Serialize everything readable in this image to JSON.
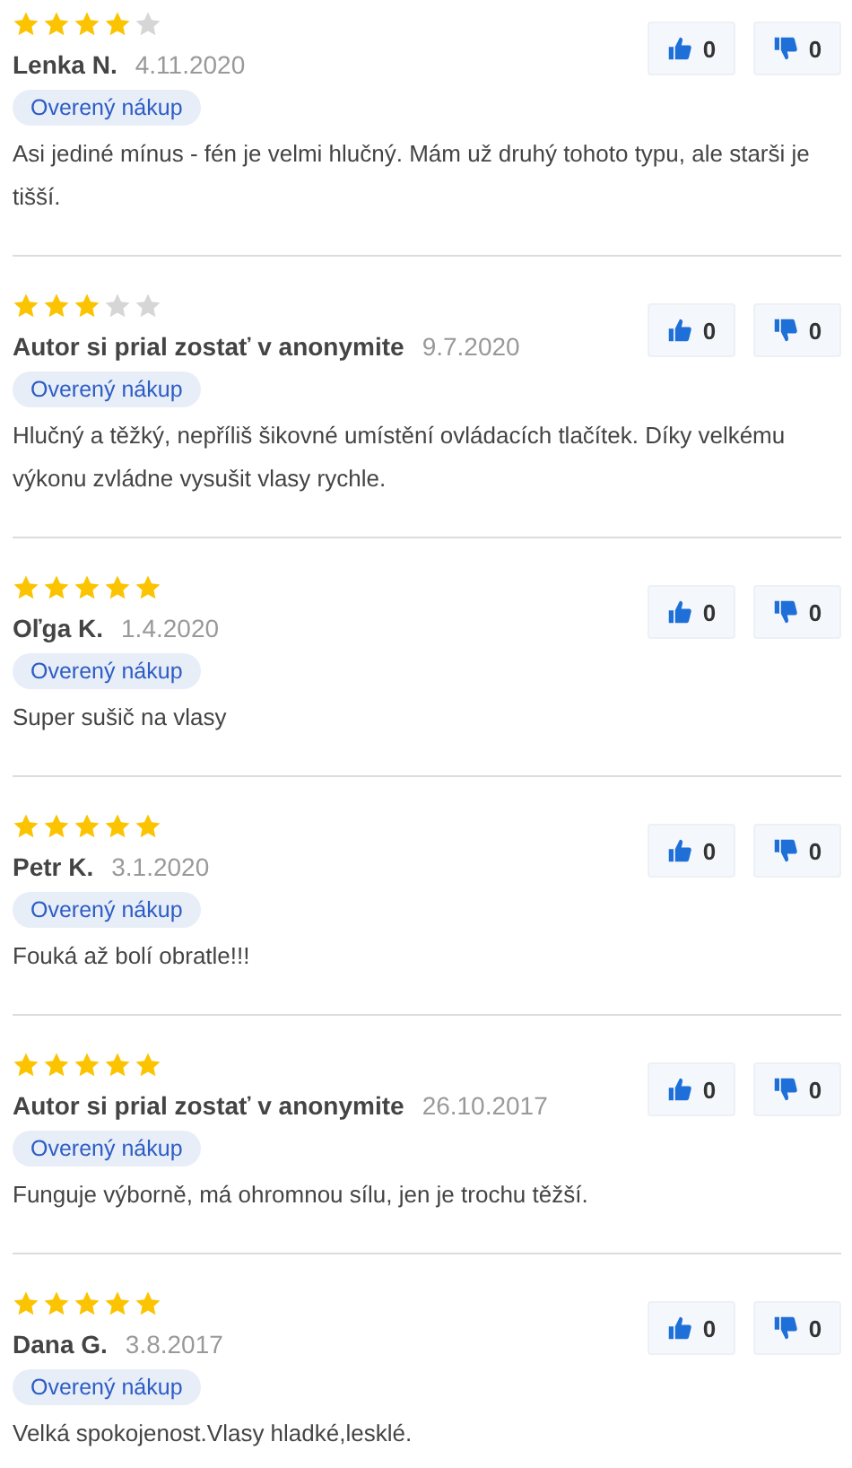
{
  "reviews": [
    {
      "stars": 4,
      "author": "Lenka N.",
      "date": "4.11.2020",
      "badge": "Overený nákup",
      "text": "Asi jediné mínus - fén je velmi hlučný. Mám už druhý tohoto typu, ale starši je tišší.",
      "likes": "0",
      "dislikes": "0"
    },
    {
      "stars": 3,
      "author": "Autor si prial zostať v anonymite",
      "date": "9.7.2020",
      "badge": "Overený nákup",
      "text": "Hlučný a těžký, nepříliš šikovné umístění ovládacích tlačítek. Díky velkému výkonu zvládne vysušit vlasy rychle.",
      "likes": "0",
      "dislikes": "0"
    },
    {
      "stars": 5,
      "author": "Oľga K.",
      "date": "1.4.2020",
      "badge": "Overený nákup",
      "text": "Super sušič na vlasy",
      "likes": "0",
      "dislikes": "0"
    },
    {
      "stars": 5,
      "author": "Petr K.",
      "date": "3.1.2020",
      "badge": "Overený nákup",
      "text": "Fouká až bolí obratle!!!",
      "likes": "0",
      "dislikes": "0"
    },
    {
      "stars": 5,
      "author": "Autor si prial zostať v anonymite",
      "date": "26.10.2017",
      "badge": "Overený nákup",
      "text": "Funguje výborně, má ohromnou sílu, jen je trochu těžší.",
      "likes": "0",
      "dislikes": "0"
    },
    {
      "stars": 5,
      "author": "Dana G.",
      "date": "3.8.2017",
      "badge": "Overený nákup",
      "text": "Velká spokojenost.Vlasy hladké,lesklé.",
      "likes": "0",
      "dislikes": "0"
    }
  ]
}
